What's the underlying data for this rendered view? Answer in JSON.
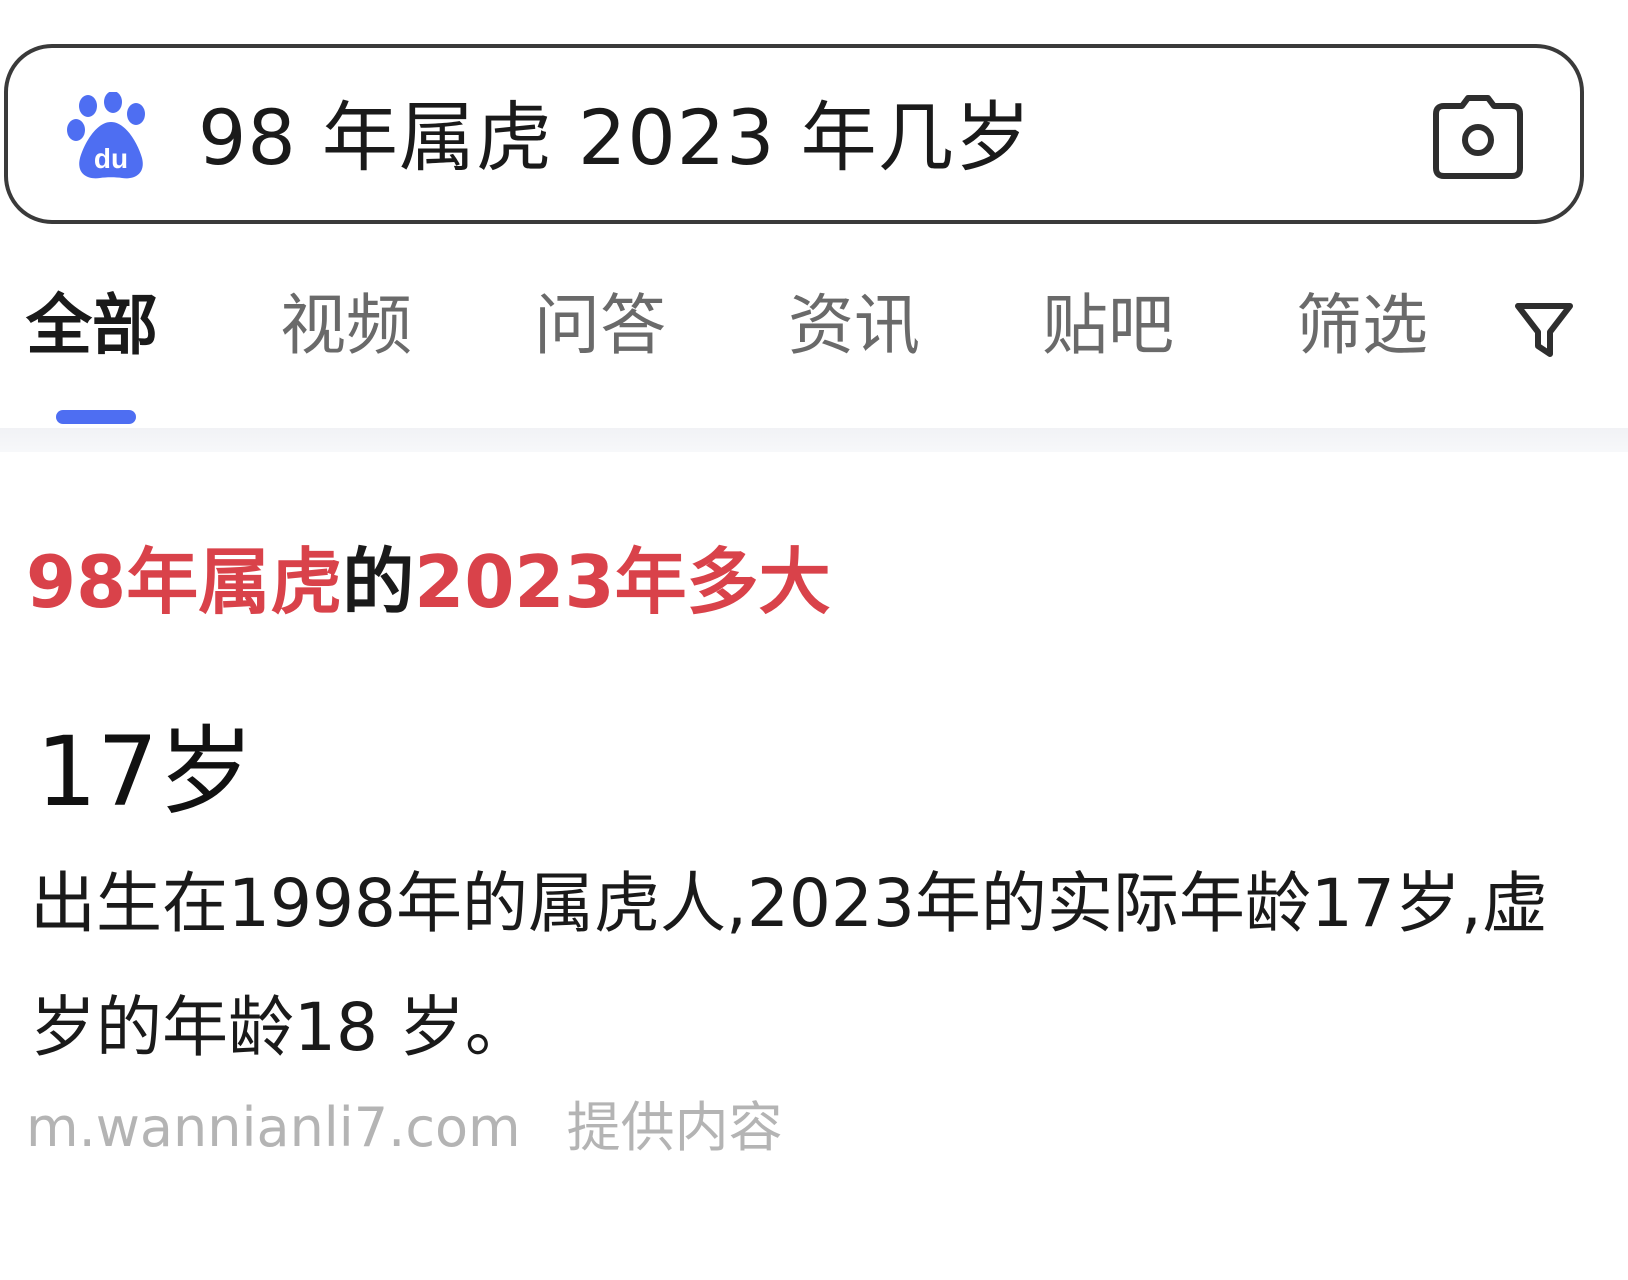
{
  "search": {
    "logo_icon": "baidu-paw-icon",
    "query": "98 年属虎 2023 年几岁",
    "camera_icon": "camera-icon"
  },
  "tabs": [
    {
      "label": "全部",
      "active": true
    },
    {
      "label": "视频",
      "active": false
    },
    {
      "label": "问答",
      "active": false
    },
    {
      "label": "资讯",
      "active": false
    },
    {
      "label": "贴吧",
      "active": false
    },
    {
      "label": "筛选",
      "active": false
    }
  ],
  "filter_icon": "funnel-icon",
  "result": {
    "title_parts": {
      "part1": "98年属虎",
      "part2": "的",
      "part3": "2023年多大"
    },
    "answer": "17岁",
    "description": " 出生在1998年的属虎人,2023年的实际年龄17岁,虚岁的年龄18 岁。",
    "source_domain": "m.wannianli7.com",
    "source_provider": "提供内容"
  },
  "colors": {
    "accent": "#4e6ef2",
    "highlight": "#d9424a",
    "muted": "#b4b4b4"
  }
}
